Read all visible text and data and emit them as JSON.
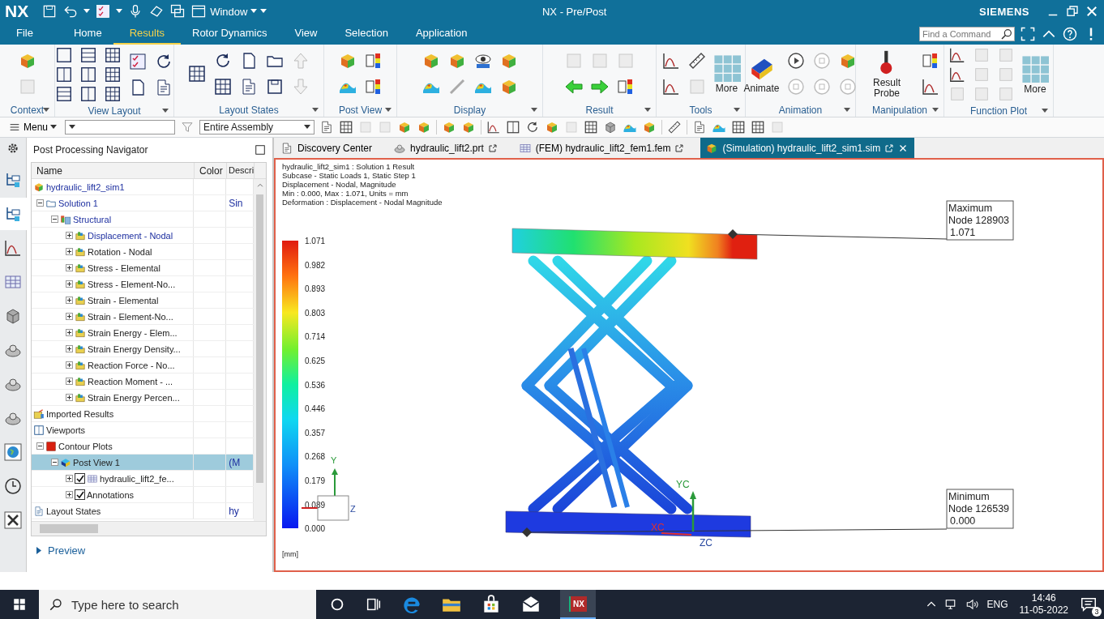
{
  "title_bar": {
    "logo": "NX",
    "window_menu": "Window",
    "title": "NX - Pre/Post",
    "brand": "SIEMENS"
  },
  "menu_tabs": [
    {
      "label": "File",
      "selected": false
    },
    {
      "label": "Home",
      "selected": false
    },
    {
      "label": "Results",
      "selected": true
    },
    {
      "label": "Rotor Dynamics",
      "selected": false
    },
    {
      "label": "View",
      "selected": false
    },
    {
      "label": "Selection",
      "selected": false
    },
    {
      "label": "Application",
      "selected": false
    }
  ],
  "command_search": {
    "placeholder": "Find a Command"
  },
  "ribbon_groups": [
    {
      "label": "Context"
    },
    {
      "label": "View Layout"
    },
    {
      "label": "Layout States"
    },
    {
      "label": "Post View"
    },
    {
      "label": "Display"
    },
    {
      "label": "Result"
    },
    {
      "label": "Tools",
      "buttons": [
        "More"
      ]
    },
    {
      "label": "Animation",
      "buttons": [
        "Animate"
      ]
    },
    {
      "label": "Manipulation",
      "buttons": [
        "Result Probe"
      ]
    },
    {
      "label": "Function Plot",
      "buttons": [
        "More"
      ]
    }
  ],
  "toolbar": {
    "menu": "Menu",
    "selection_filter": "Entire Assembly"
  },
  "navigator": {
    "title": "Post Processing Navigator",
    "columns": [
      "Name",
      "Color",
      "Descri"
    ],
    "preview": "Preview",
    "tree": [
      {
        "label": "hydraulic_lift2_sim1",
        "kind": "sim",
        "active": true,
        "selected": false,
        "children": [
          {
            "label": "Solution 1",
            "kind": "folder",
            "active": true,
            "selected": false,
            "expanded": true,
            "description": "Sin",
            "children": [
              {
                "label": "Structural",
                "kind": "structural",
                "active": true,
                "selected": false,
                "expanded": true,
                "children": [
                  {
                    "label": "Displacement - Nodal",
                    "kind": "result",
                    "active": true,
                    "selected": false,
                    "expanded": false
                  },
                  {
                    "label": "Rotation - Nodal",
                    "kind": "result",
                    "active": false,
                    "selected": false,
                    "expanded": false
                  },
                  {
                    "label": "Stress - Elemental",
                    "kind": "result",
                    "active": false,
                    "selected": false,
                    "expanded": false
                  },
                  {
                    "label": "Stress - Element-No...",
                    "kind": "result",
                    "active": false,
                    "selected": false,
                    "expanded": false
                  },
                  {
                    "label": "Strain - Elemental",
                    "kind": "result",
                    "active": false,
                    "selected": false,
                    "expanded": false
                  },
                  {
                    "label": "Strain - Element-No...",
                    "kind": "result",
                    "active": false,
                    "selected": false,
                    "expanded": false
                  },
                  {
                    "label": "Strain Energy - Elem...",
                    "kind": "result",
                    "active": false,
                    "selected": false,
                    "expanded": false
                  },
                  {
                    "label": "Strain Energy Density...",
                    "kind": "result",
                    "active": false,
                    "selected": false,
                    "expanded": false
                  },
                  {
                    "label": "Reaction Force - No...",
                    "kind": "result",
                    "active": false,
                    "selected": false,
                    "expanded": false
                  },
                  {
                    "label": "Reaction Moment - ...",
                    "kind": "result",
                    "active": false,
                    "selected": false,
                    "expanded": false
                  },
                  {
                    "label": "Strain Energy Percen...",
                    "kind": "result",
                    "active": false,
                    "selected": false,
                    "expanded": false
                  }
                ]
              }
            ]
          }
        ]
      },
      {
        "label": "Imported Results",
        "kind": "imported",
        "active": false,
        "selected": false
      },
      {
        "label": "Viewports",
        "kind": "viewports",
        "active": false,
        "selected": false,
        "children": [
          {
            "label": "Contour Plots",
            "kind": "contour",
            "active": false,
            "selected": false,
            "expanded": true,
            "children": [
              {
                "label": "Post View 1",
                "kind": "postview",
                "active": false,
                "selected": true,
                "expanded": true,
                "description": "(M",
                "children": [
                  {
                    "label": "hydraulic_lift2_fe...",
                    "kind": "mesh",
                    "active": false,
                    "selected": false,
                    "expanded": false,
                    "checked": true
                  },
                  {
                    "label": "Annotations",
                    "kind": "annotations",
                    "active": false,
                    "selected": false,
                    "expanded": false,
                    "checked": true
                  }
                ]
              }
            ]
          }
        ]
      },
      {
        "label": "Layout States",
        "kind": "layout",
        "active": false,
        "selected": false,
        "description": "hy"
      }
    ]
  },
  "document_tabs": [
    {
      "label": "Discovery Center",
      "kind": "discovery",
      "selected": false
    },
    {
      "label": "hydraulic_lift2.prt",
      "kind": "part",
      "selected": false
    },
    {
      "label": "(FEM) hydraulic_lift2_fem1.fem",
      "kind": "fem",
      "selected": false
    },
    {
      "label": "(Simulation) hydraulic_lift2_sim1.sim",
      "kind": "sim",
      "selected": true
    }
  ],
  "viewport": {
    "header_lines": [
      "hydraulic_lift2_sim1 : Solution 1 Result",
      "Subcase - Static Loads 1, Static Step 1",
      "Displacement - Nodal, Magnitude",
      "Min : 0.000, Max : 1.071, Units = mm",
      "Deformation : Displacement - Nodal Magnitude"
    ],
    "legend_values": [
      "1.071",
      "0.982",
      "0.893",
      "0.803",
      "0.714",
      "0.625",
      "0.536",
      "0.446",
      "0.357",
      "0.268",
      "0.179",
      "0.089",
      "0.000"
    ],
    "legend_unit": "[mm]",
    "max_label": [
      "Maximum",
      "Node 128903",
      "1.071"
    ],
    "min_label": [
      "Minimum",
      "Node 126539",
      "0.000"
    ],
    "view_triad": [
      "Y",
      "Z"
    ],
    "wcs_triad": [
      "YC",
      "XC",
      "ZC"
    ]
  },
  "taskbar": {
    "search_placeholder": "Type here to search",
    "app_label": "NX",
    "language": "ENG",
    "time": "14:46",
    "date": "11-05-2022",
    "notifications": "3"
  }
}
